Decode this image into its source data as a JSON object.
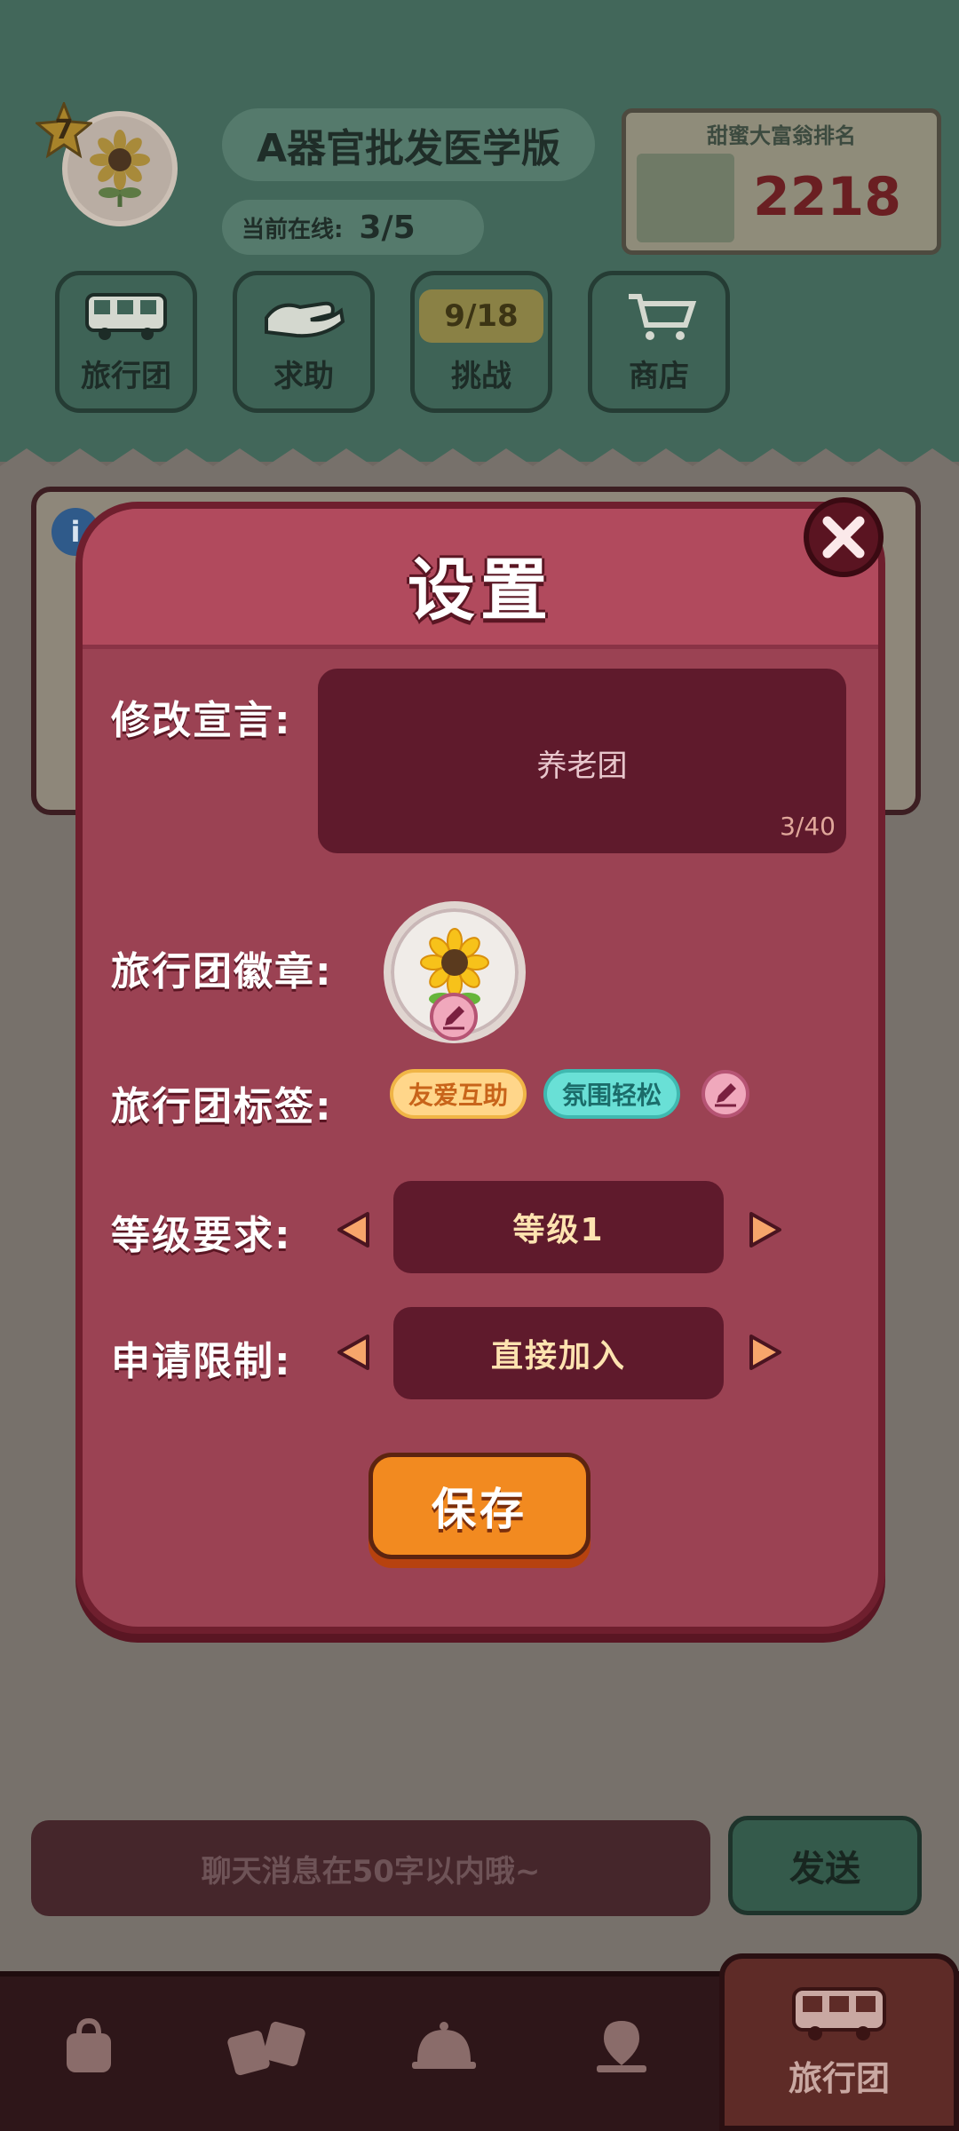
{
  "background": {
    "team": {
      "level": "7",
      "name": "A器官批发医学版",
      "online_label": "当前在线:",
      "online_count": "3/5"
    },
    "rank_board": {
      "title": "甜蜜大富翁排名",
      "value": "2218"
    },
    "nav": [
      {
        "label": "旅行团",
        "icon": "bus-icon"
      },
      {
        "label": "求助",
        "icon": "helping-hand-icon"
      },
      {
        "label": "挑战",
        "icon": "challenge-counter",
        "badge": "9/18"
      },
      {
        "label": "商店",
        "icon": "cart-icon"
      }
    ],
    "chat": {
      "placeholder": "聊天消息在50字以内哦~",
      "send_label": "发送"
    },
    "bottom_tabs": [
      {
        "icon": "bag-icon"
      },
      {
        "icon": "cards-icon"
      },
      {
        "icon": "service-bell-icon"
      },
      {
        "icon": "map-pin-icon"
      },
      {
        "icon": "bus-icon",
        "label": "旅行团",
        "active": true
      }
    ]
  },
  "modal": {
    "title": "设置",
    "slogan": {
      "label": "修改宣言:",
      "value": "养老团",
      "count": "3/40"
    },
    "badge": {
      "label": "旅行团徽章:",
      "icon": "sunflower-icon"
    },
    "tags": {
      "label": "旅行团标签:",
      "items": [
        "友爱互助",
        "氛围轻松"
      ]
    },
    "level_requirement": {
      "label": "等级要求:",
      "value": "等级1"
    },
    "apply_limit": {
      "label": "申请限制:",
      "value": "直接加入"
    },
    "save_label": "保存"
  },
  "colors": {
    "modal_bg": "#9b4253",
    "modal_border": "#6f1f2e",
    "field_bg": "#5f1a2c",
    "save_button": "#f28a20",
    "tag_yellow": "#ffd68a",
    "tag_teal": "#69e0d6"
  }
}
